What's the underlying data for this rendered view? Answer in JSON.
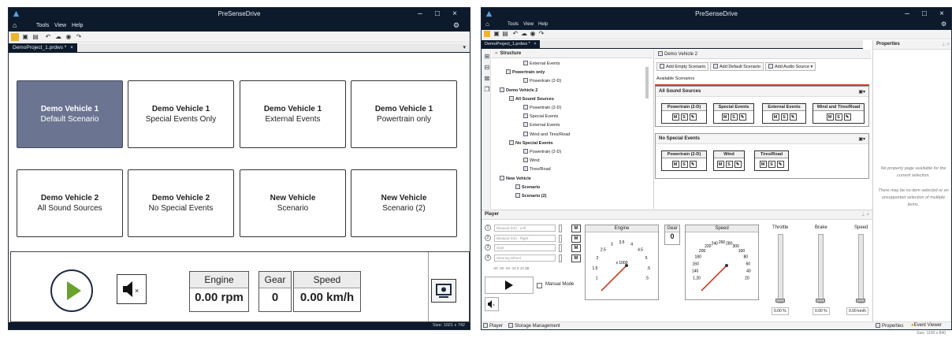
{
  "left_window": {
    "title": "PreSenseDrive",
    "menu": {
      "tools": "Tools",
      "view": "View",
      "help": "Help"
    },
    "doc_tab": "DemoProject_1.prdws *",
    "doc_tab_close": "×",
    "dropdown_arrow": "▾",
    "scenarios": [
      {
        "line1": "Demo Vehicle 1",
        "line2": "Default Scenario",
        "selected": true
      },
      {
        "line1": "Demo Vehicle 1",
        "line2": "Special Events Only",
        "selected": false
      },
      {
        "line1": "Demo Vehicle 1",
        "line2": "External Events",
        "selected": false
      },
      {
        "line1": "Demo Vehicle 1",
        "line2": "Powertrain only",
        "selected": false
      },
      {
        "line1": "Demo Vehicle 2",
        "line2": "All Sound Sources",
        "selected": false
      },
      {
        "line1": "Demo Vehicle 2",
        "line2": "No Special Events",
        "selected": false
      },
      {
        "line1": "New Vehicle",
        "line2": "Scenario",
        "selected": false
      },
      {
        "line1": "New Vehicle",
        "line2": "Scenario (2)",
        "selected": false
      }
    ],
    "player": {
      "engine_label": "Engine",
      "engine_value": "0.00 rpm",
      "gear_label": "Gear",
      "gear_value": "0",
      "speed_label": "Speed",
      "speed_value": "0.00 km/h"
    },
    "status": "Size: 1021 x 742"
  },
  "right_window": {
    "title": "PreSenseDrive",
    "menu": {
      "tools": "Tools",
      "view": "View",
      "help": "Help"
    },
    "doc_tab": "DemoProject_1.prdws *",
    "doc_tab_close": "×",
    "structure": {
      "header": "Structure",
      "items": [
        {
          "label": "External Events",
          "bold": false
        },
        {
          "label": "Powertrain only",
          "bold": true
        },
        {
          "label": "Powertrain (2-D)",
          "bold": false
        },
        {
          "label": "Demo Vehicle 2",
          "bold": true
        },
        {
          "label": "All Sound Sources",
          "bold": true
        },
        {
          "label": "Powertrain (2-D)",
          "bold": false
        },
        {
          "label": "Special Events",
          "bold": false
        },
        {
          "label": "External Events",
          "bold": false
        },
        {
          "label": "Wind and Tires/Road",
          "bold": false
        },
        {
          "label": "No Special Events",
          "bold": true
        },
        {
          "label": "Powertrain (2-D)",
          "bold": false
        },
        {
          "label": "Wind",
          "bold": false
        },
        {
          "label": "Tires/Road",
          "bold": false
        },
        {
          "label": "New Vehicle",
          "bold": true
        },
        {
          "label": "Scenario",
          "bold": true
        },
        {
          "label": "Scenario (2)",
          "bold": true
        }
      ]
    },
    "detail": {
      "header": "Demo Vehicle 2",
      "add_empty": "Add Empty Scenario",
      "add_default": "Add Default Scenario",
      "add_audio": "Add Audio Source ▾",
      "available_label": "Available Scenarios",
      "group1": {
        "title": "All Sound Sources",
        "sources": [
          "Powertrain (2-D)",
          "Special Events",
          "External Events",
          "Wind and Tires/Road"
        ]
      },
      "group2": {
        "title": "No Special Events",
        "sources": [
          "Powertrain (2-D)",
          "Wind",
          "Tires/Road"
        ]
      },
      "btn_m": "M",
      "btn_s": "S"
    },
    "properties": {
      "header": "Properties",
      "msg1": "No property page available for the current selection.",
      "msg2": "There may be no item selected or an unsupported selection of multiple items."
    },
    "player": {
      "header": "Player",
      "channels": [
        {
          "num": "1",
          "name": "Binaural (02) - Left"
        },
        {
          "num": "2",
          "name": "Binaural (02) - Right"
        },
        {
          "num": "3",
          "name": "Seat"
        },
        {
          "num": "4",
          "name": "Steering Wheel"
        }
      ],
      "db_scale": "-40 -30 -20 -10 0 10 dB",
      "manual_mode": "Manual Mode",
      "engine_label": "Engine",
      "engine_unit": "x 1000",
      "engine_ticks": [
        "1",
        "1.5",
        "2",
        "2.5",
        "3",
        "3.5",
        "4",
        "4.5",
        "5",
        ".5",
        ".5"
      ],
      "gear_label": "Gear",
      "gear_value": "0",
      "speed_label": "Speed",
      "speed_ticks": [
        "1.20",
        "140",
        "160",
        "180",
        "200",
        "220",
        "240",
        "260",
        "280",
        "300",
        "100",
        "80",
        "60",
        "40",
        "20"
      ],
      "throttle_label": "Throttle",
      "brake_label": "Brake",
      "speed_slider_label": "Speed",
      "throttle_value": "0.00 %",
      "brake_value": "0.00 %",
      "speed_value": "0.00 km/h"
    },
    "bottom_tabs": {
      "player": "Player",
      "storage": "Storage Management",
      "properties": "Properties",
      "events": "Event Viewer"
    },
    "status": "Size: 1190 x 840"
  },
  "colors": {
    "titlebar": "#0d1a2b",
    "selected_card": "#6b7591",
    "play_green": "#6aa02c",
    "accent_red": "#c9402c"
  }
}
